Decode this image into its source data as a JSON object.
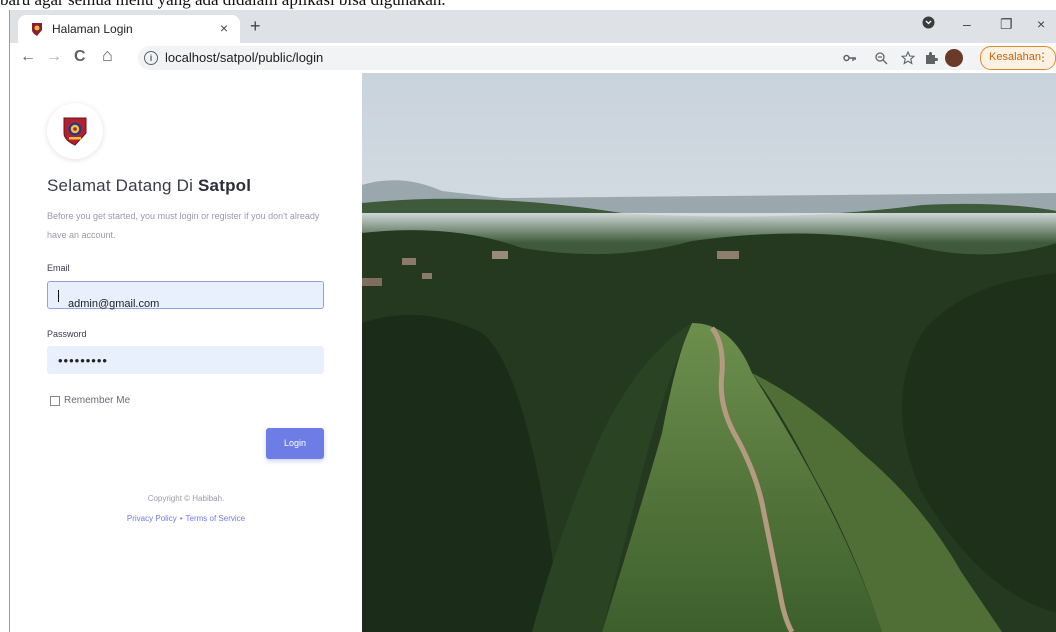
{
  "document": {
    "caption": "baru agar semua menu yang ada didalam aplikasi bisa digunakan."
  },
  "browser": {
    "tab": {
      "title": "Halaman Login",
      "close": "×"
    },
    "new_tab": "+",
    "window_controls": {
      "minimize": "–",
      "restore": "❐",
      "close": "×"
    },
    "nav": {
      "back": "←",
      "forward": "→",
      "reload": "C",
      "home": "⌂"
    },
    "url": "localhost/satpol/public/login",
    "error_badge": {
      "label": "Kesalahan",
      "menu": "⋮"
    }
  },
  "login": {
    "welcome_prefix": "Selamat Datang Di ",
    "welcome_brand": "Satpol",
    "subtitle": "Before you get started, you must login or register if you don't already have an account.",
    "email_label": "Email",
    "email_value": "admin@gmail.com",
    "password_label": "Password",
    "password_value": "•••••••••",
    "remember_label": "Remember Me",
    "remember_checked": false,
    "login_button": "Login",
    "copyright": "Copyright © Habibah.",
    "privacy_link": "Privacy Policy",
    "separator": "•",
    "terms_link": "Terms of Service"
  },
  "colors": {
    "accent": "#6e7ce6",
    "input_bg": "#e8f0fe",
    "error": "#c0650a"
  },
  "icons": [
    "info-icon",
    "key-icon",
    "zoom-icon",
    "star-icon",
    "extensions-icon",
    "profile-avatar",
    "dark-mode-icon"
  ]
}
